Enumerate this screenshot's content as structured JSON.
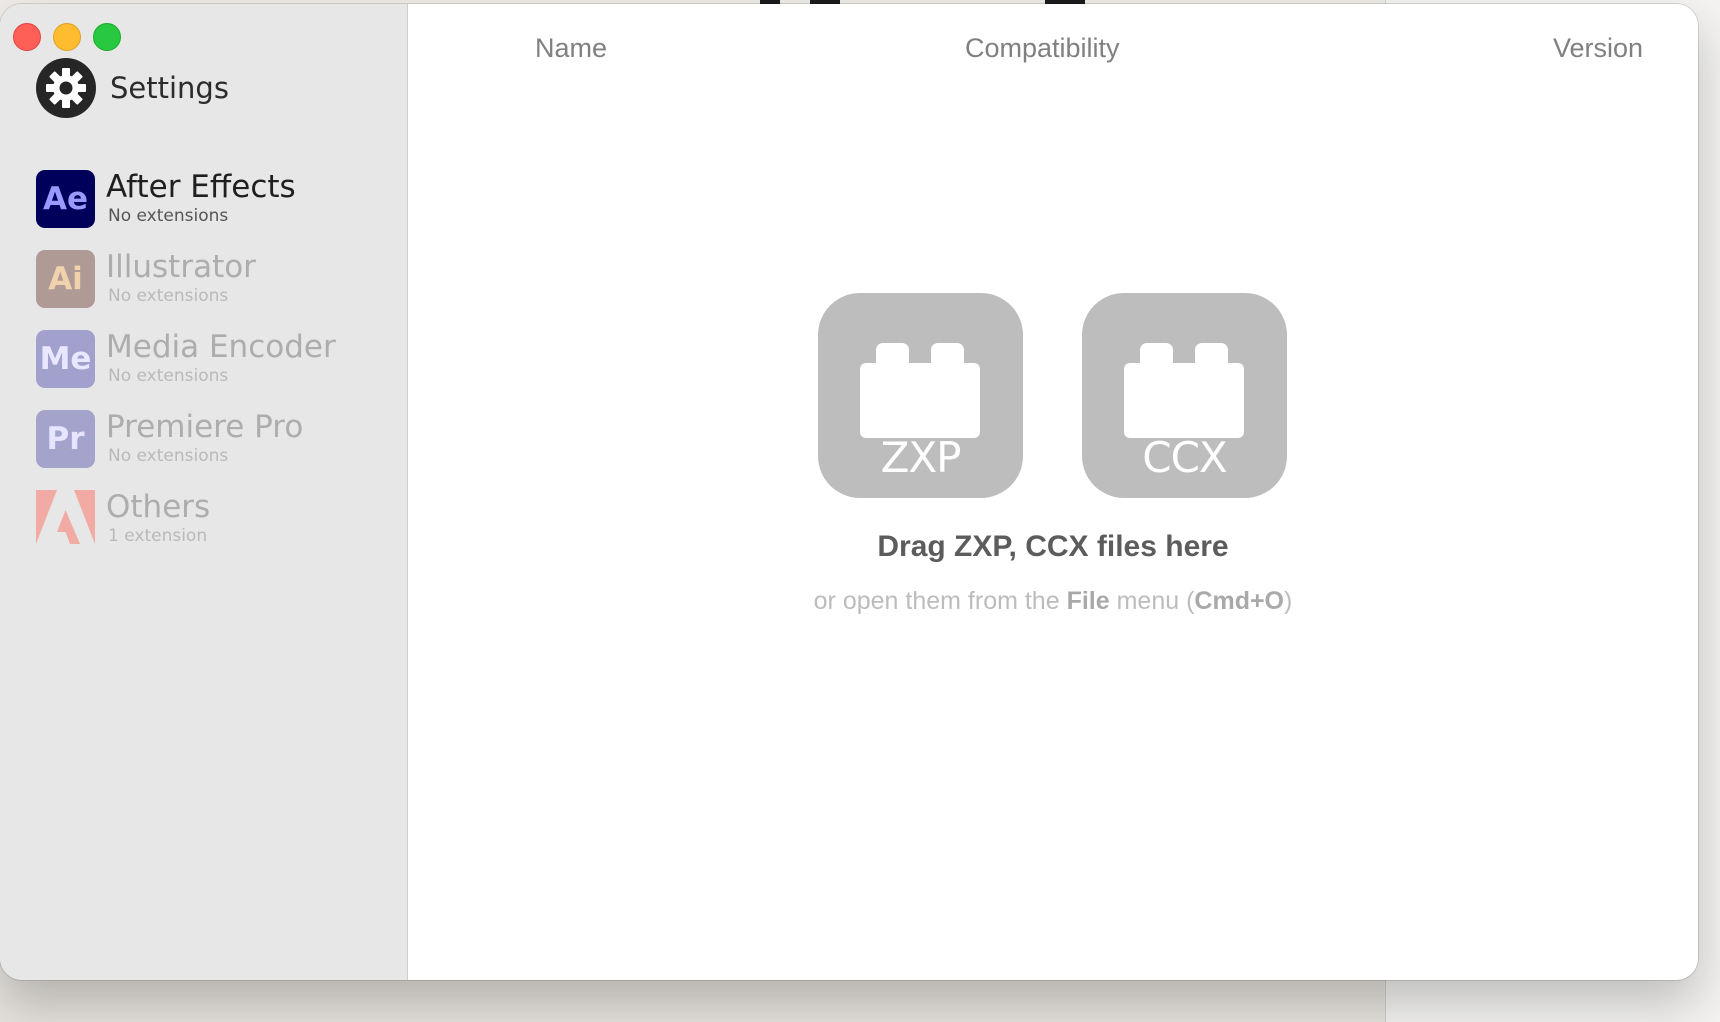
{
  "sidebar": {
    "settings_label": "Settings",
    "apps": [
      {
        "icon_text": "Ae",
        "name": "After Effects",
        "status": "No extensions",
        "icon_bg": "#00005b",
        "icon_fg": "#9999ff"
      },
      {
        "icon_text": "Ai",
        "name": "Illustrator",
        "status": "No extensions",
        "icon_bg": "#b09a96",
        "icon_fg": "#f0d2ae"
      },
      {
        "icon_text": "Me",
        "name": "Media Encoder",
        "status": "No extensions",
        "icon_bg": "#a2a0cd",
        "icon_fg": "#e9e6ff"
      },
      {
        "icon_text": "Pr",
        "name": "Premiere Pro",
        "status": "No extensions",
        "icon_bg": "#a4a3cc",
        "icon_fg": "#e6e4ff"
      },
      {
        "icon_text": "",
        "name": "Others",
        "status": "1 extension",
        "icon_bg": "#f2aba4",
        "icon_fg": "#ffffff"
      }
    ]
  },
  "table": {
    "columns": [
      "Name",
      "Compatibility",
      "Version"
    ]
  },
  "dropzone": {
    "formats": [
      "ZXP",
      "CCX"
    ],
    "title": "Drag ZXP, CCX files here",
    "hint_before": "or open them from the ",
    "hint_file": "File",
    "hint_middle": " menu (",
    "hint_shortcut": "Cmd+O",
    "hint_after": ")"
  },
  "colors": {
    "close": "#fe5f57",
    "minimize": "#febc2e",
    "zoom": "#28c840",
    "drop_icon": "#bdbdbd"
  },
  "icons": {
    "settings": "gear-icon",
    "others": "adobe-logo-icon",
    "dropzone": "plugin-brick-icon"
  }
}
